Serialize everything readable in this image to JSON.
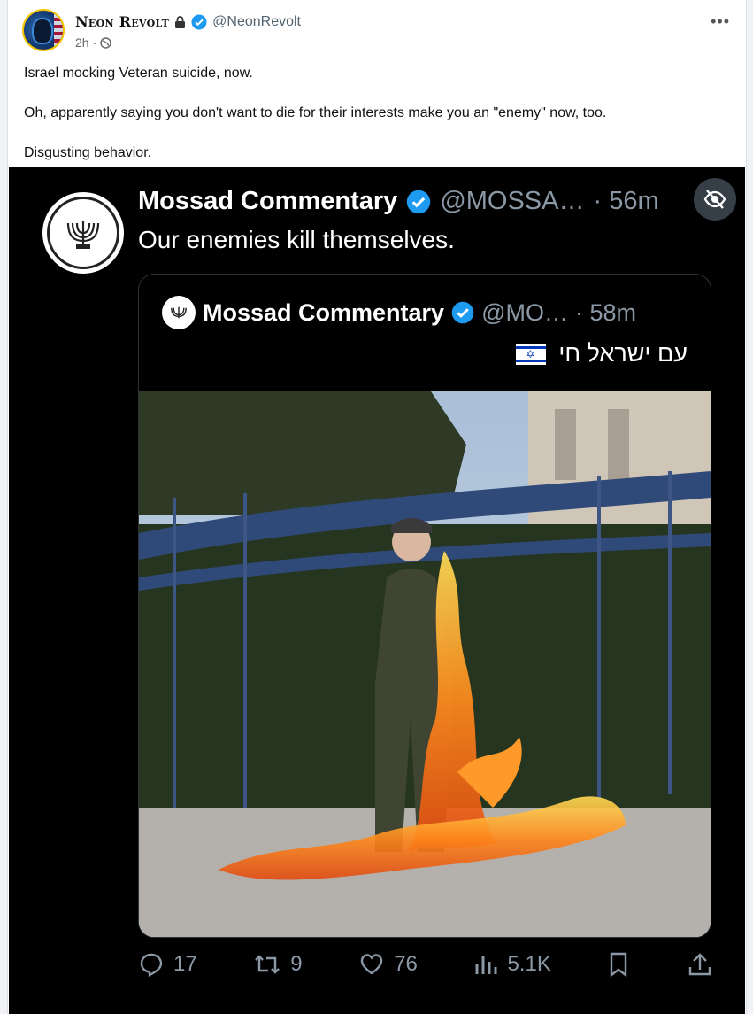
{
  "post": {
    "author_name": "Neon Revolt",
    "handle": "@NeonRevolt",
    "time": "2h",
    "separator": "·",
    "more": "•••",
    "text": [
      "Israel mocking Veteran suicide, now.",
      "Oh, apparently saying you don't want to die for their interests make you an \"enemy\" now, too.",
      "Disgusting behavior."
    ]
  },
  "embedded_tweet": {
    "name": "Mossad Commentary",
    "handle": "@MOSSA…",
    "time": "· 56m",
    "text": "Our enemies kill themselves.",
    "quoted": {
      "name": "Mossad Commentary",
      "handle": "@MO…",
      "time": "· 58m",
      "text": "עם ישראל חי"
    },
    "actions": {
      "replies": "17",
      "retweets": "9",
      "likes": "76",
      "views": "5.1K"
    }
  },
  "colors": {
    "verified": "#1d9bf0",
    "tweet_bg": "#000000",
    "muted": "#8b98a5"
  },
  "icons": [
    "lock-icon",
    "verified-icon",
    "globe-icon",
    "more-icon",
    "hide-media-icon",
    "reply-icon",
    "retweet-icon",
    "like-icon",
    "views-icon",
    "bookmark-icon",
    "share-icon"
  ]
}
